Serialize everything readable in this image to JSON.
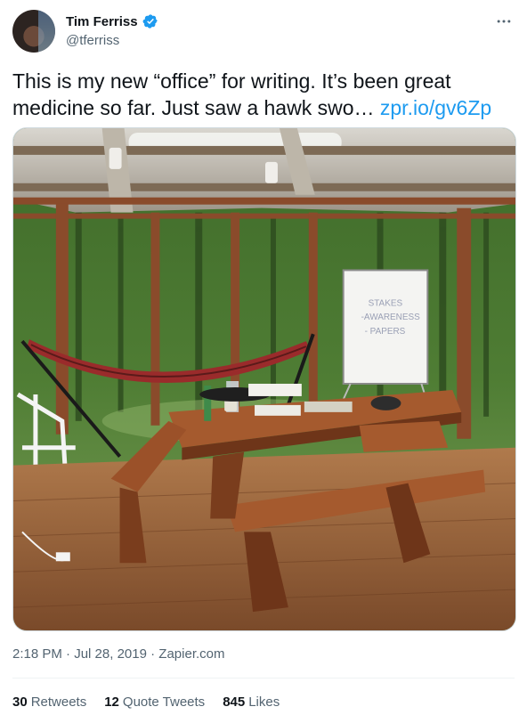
{
  "author": {
    "display_name": "Tim Ferriss",
    "handle": "@tferriss",
    "verified": true
  },
  "tweet": {
    "text": "This is my new “office” for writing. It’s been great medicine so far. Just saw a hawk swo…",
    "link": "zpr.io/gv6Zp"
  },
  "meta": {
    "time": "2:18 PM",
    "separator1": " · ",
    "date": "Jul 28, 2019",
    "separator2": " · ",
    "source": "Zapier.com"
  },
  "stats": {
    "retweets_count": "30",
    "retweets_label": "Retweets",
    "quotes_count": "12",
    "quotes_label": "Quote Tweets",
    "likes_count": "845",
    "likes_label": "Likes"
  },
  "photo": {
    "whiteboard_lines": [
      "STAKES",
      "-AWARENESS",
      "- PAPERS"
    ]
  },
  "icons": {
    "verified": "verified-badge-icon",
    "more": "more-dots-icon"
  },
  "colors": {
    "link": "#1d9bf0",
    "verified": "#1d9bf0",
    "secondary_text": "#536471"
  }
}
